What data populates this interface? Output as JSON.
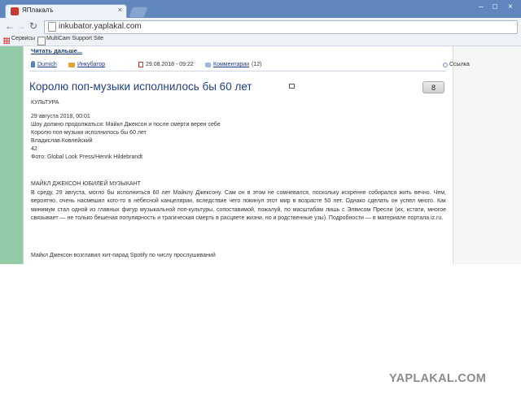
{
  "browser": {
    "tab_title": "ЯПлакалъ",
    "tab_close": "×",
    "url": "inkubator.yaplakal.com",
    "window_controls": [
      "–",
      "□",
      "×"
    ],
    "bookmarks": [
      "Сервисы",
      "MultiCam Support Site"
    ]
  },
  "post": {
    "read_more": "Читать дальше...",
    "meta": {
      "author": "Dumich",
      "section": "Инкубатор",
      "date": "29.08.2018 - 09:22",
      "comments_label": "Комментарии",
      "comments_count": "(12)",
      "link_label": "Ссылка"
    },
    "title": "Королю поп-музыки исполнилось бы 60 лет",
    "rating": "8",
    "category": "КУЛЬТУРА",
    "lines": [
      "29 августа 2018, 00:01",
      "Шоу должно продолжаться: Майкл Джексон и после смерти верен себе",
      "Королю поп-музыки исполнилось бы 60 лет",
      "Владислав Ковлейский",
      "42",
      "Фото: Global Look Press/Henrik Hildebrandt"
    ],
    "tags": "МАЙКЛ ДЖЕКСОН ЮБИЛЕЙ МУЗЫКАНТ",
    "paragraph": "В среду, 29 августа, могло бы исполниться 60 лет Майклу Джексону. Сам он в этом не сомневался, поскольку искренне собирался жить вечно. Чем, вероятно, очень насмешил кого-то в небесной канцелярии, вследствие чего покинул этот мир в возрасте 50 лет. Однако сделать он успел много. Как минимум стал одной из главных фигур музыкальной поп-культуры, сопоставимой, пожалуй, по масштабам лишь с Элвисом Пресли (их, кстати, многое связывает — не только бешеная популярность и трагическая смерть в расцвете жизни, но и родственные узы). Подробности — в материале портала iz.ru.",
    "last_line": "Майкл Джексон возглавил хит-парад Spotify по числу прослушиваний"
  },
  "watermark": "YAPLAKAL.COM"
}
